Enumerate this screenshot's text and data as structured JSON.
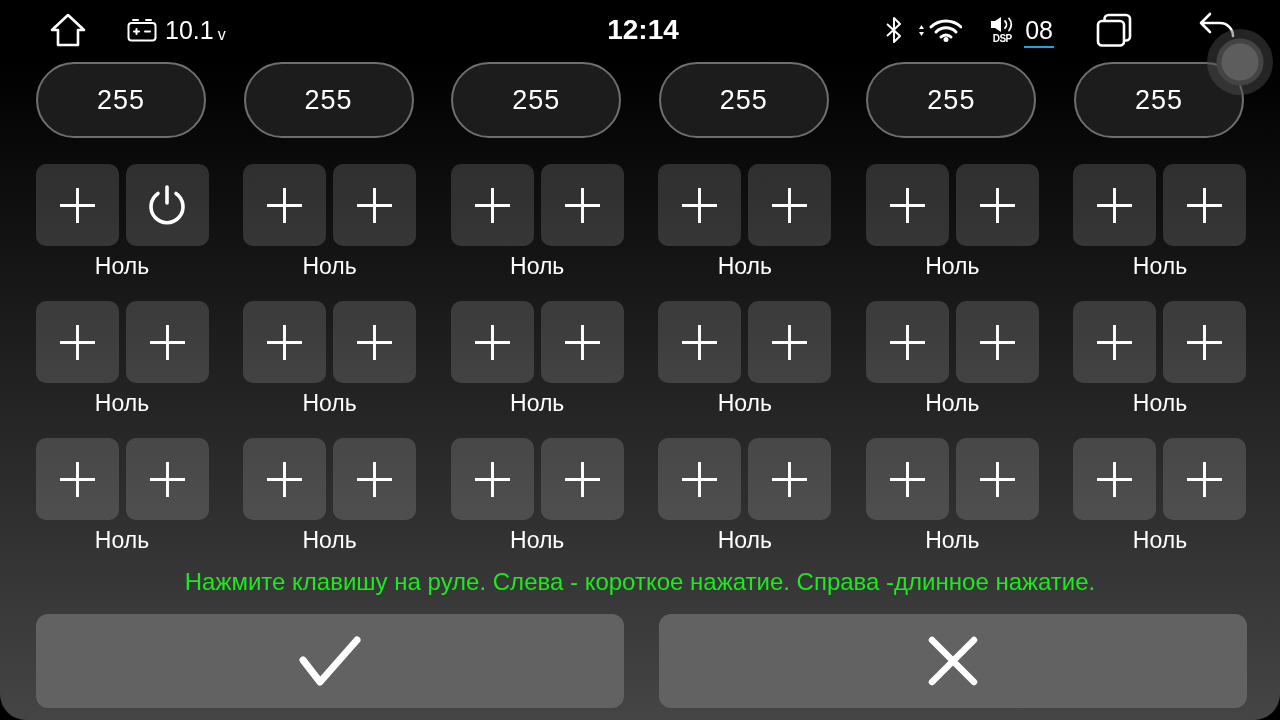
{
  "status_bar": {
    "voltage": "10.1",
    "voltage_unit": "v",
    "time": "12:14",
    "dsp_label": "DSP",
    "volume": "08"
  },
  "value_pills": [
    "255",
    "255",
    "255",
    "255",
    "255",
    "255"
  ],
  "key_slots": [
    {
      "keys": [
        {
          "kind": "plus"
        },
        {
          "kind": "power"
        }
      ],
      "label": "Ноль"
    },
    {
      "keys": [
        {
          "kind": "plus"
        },
        {
          "kind": "plus"
        }
      ],
      "label": "Ноль"
    },
    {
      "keys": [
        {
          "kind": "plus"
        },
        {
          "kind": "plus"
        }
      ],
      "label": "Ноль"
    },
    {
      "keys": [
        {
          "kind": "plus"
        },
        {
          "kind": "plus"
        }
      ],
      "label": "Ноль"
    },
    {
      "keys": [
        {
          "kind": "plus"
        },
        {
          "kind": "plus"
        }
      ],
      "label": "Ноль"
    },
    {
      "keys": [
        {
          "kind": "plus"
        },
        {
          "kind": "plus"
        }
      ],
      "label": "Ноль"
    },
    {
      "keys": [
        {
          "kind": "plus"
        },
        {
          "kind": "plus"
        }
      ],
      "label": "Ноль"
    },
    {
      "keys": [
        {
          "kind": "plus"
        },
        {
          "kind": "plus"
        }
      ],
      "label": "Ноль"
    },
    {
      "keys": [
        {
          "kind": "plus"
        },
        {
          "kind": "plus"
        }
      ],
      "label": "Ноль"
    },
    {
      "keys": [
        {
          "kind": "plus"
        },
        {
          "kind": "plus"
        }
      ],
      "label": "Ноль"
    },
    {
      "keys": [
        {
          "kind": "plus"
        },
        {
          "kind": "plus"
        }
      ],
      "label": "Ноль"
    },
    {
      "keys": [
        {
          "kind": "plus"
        },
        {
          "kind": "plus"
        }
      ],
      "label": "Ноль"
    },
    {
      "keys": [
        {
          "kind": "plus"
        },
        {
          "kind": "plus"
        }
      ],
      "label": "Ноль"
    },
    {
      "keys": [
        {
          "kind": "plus"
        },
        {
          "kind": "plus"
        }
      ],
      "label": "Ноль"
    },
    {
      "keys": [
        {
          "kind": "plus"
        },
        {
          "kind": "plus"
        }
      ],
      "label": "Ноль"
    },
    {
      "keys": [
        {
          "kind": "plus"
        },
        {
          "kind": "plus"
        }
      ],
      "label": "Ноль"
    },
    {
      "keys": [
        {
          "kind": "plus"
        },
        {
          "kind": "plus"
        }
      ],
      "label": "Ноль"
    },
    {
      "keys": [
        {
          "kind": "plus"
        },
        {
          "kind": "plus"
        }
      ],
      "label": "Ноль"
    }
  ],
  "hint": "Нажмите клавишу на руле. Слева - короткое нажатие. Справа -длинное нажатие.",
  "actions": [
    {
      "kind": "confirm"
    },
    {
      "kind": "cancel"
    }
  ]
}
